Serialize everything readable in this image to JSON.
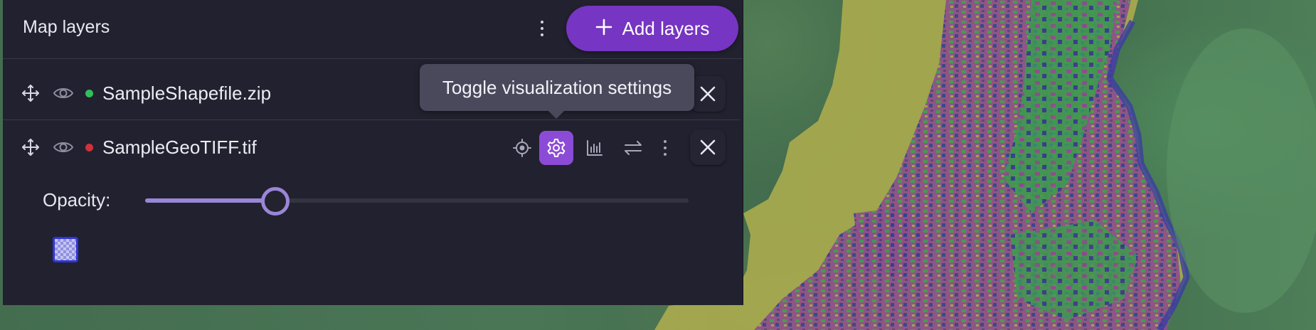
{
  "panel": {
    "title": "Map layers",
    "add_button_label": "Add layers",
    "add_button_icon": "plus-icon",
    "menu_icon": "kebab-menu-icon"
  },
  "layers": [
    {
      "name": "SampleShapefile.zip",
      "status_color": "#2fbf5b",
      "visible": true
    },
    {
      "name": "SampleGeoTIFF.tif",
      "status_color": "#d0323a",
      "visible": true,
      "tools": [
        "locate-icon",
        "gear-icon",
        "histogram-icon",
        "swap-icon",
        "kebab-menu-icon"
      ],
      "active_tool": "gear-icon",
      "opacity_label": "Opacity:",
      "opacity_value": 0.24,
      "swatch_color": "#3035d8"
    }
  ],
  "tooltip": {
    "text": "Toggle visualization settings"
  },
  "colors": {
    "accent": "#7635c2",
    "active_tool": "#8c4bd6",
    "panel_bg": "#22212f",
    "slider": "#9a86d6"
  }
}
